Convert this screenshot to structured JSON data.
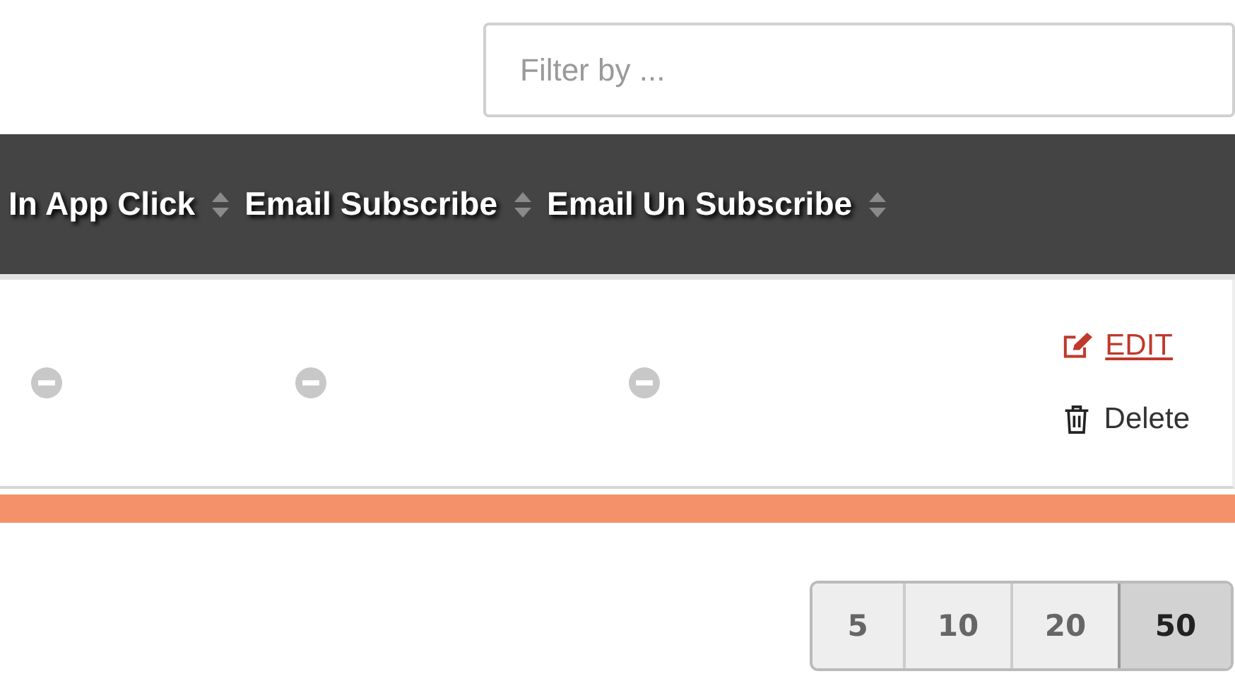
{
  "filter": {
    "placeholder": "Filter by ..."
  },
  "table": {
    "columns": [
      {
        "label": "In App Click",
        "sortable": true
      },
      {
        "label": "Email Subscribe",
        "sortable": true
      },
      {
        "label": "Email Un Subscribe",
        "sortable": true
      }
    ],
    "rows": [
      {
        "cells": [
          {
            "enabled": false
          },
          {
            "enabled": false
          },
          {
            "enabled": false
          }
        ],
        "actions": [
          {
            "kind": "edit",
            "label": "EDIT"
          },
          {
            "kind": "delete",
            "label": "Delete"
          }
        ]
      }
    ]
  },
  "page_sizes": [
    {
      "label": "5",
      "selected": false
    },
    {
      "label": "10",
      "selected": false
    },
    {
      "label": "20",
      "selected": false
    },
    {
      "label": "50",
      "selected": true
    }
  ]
}
